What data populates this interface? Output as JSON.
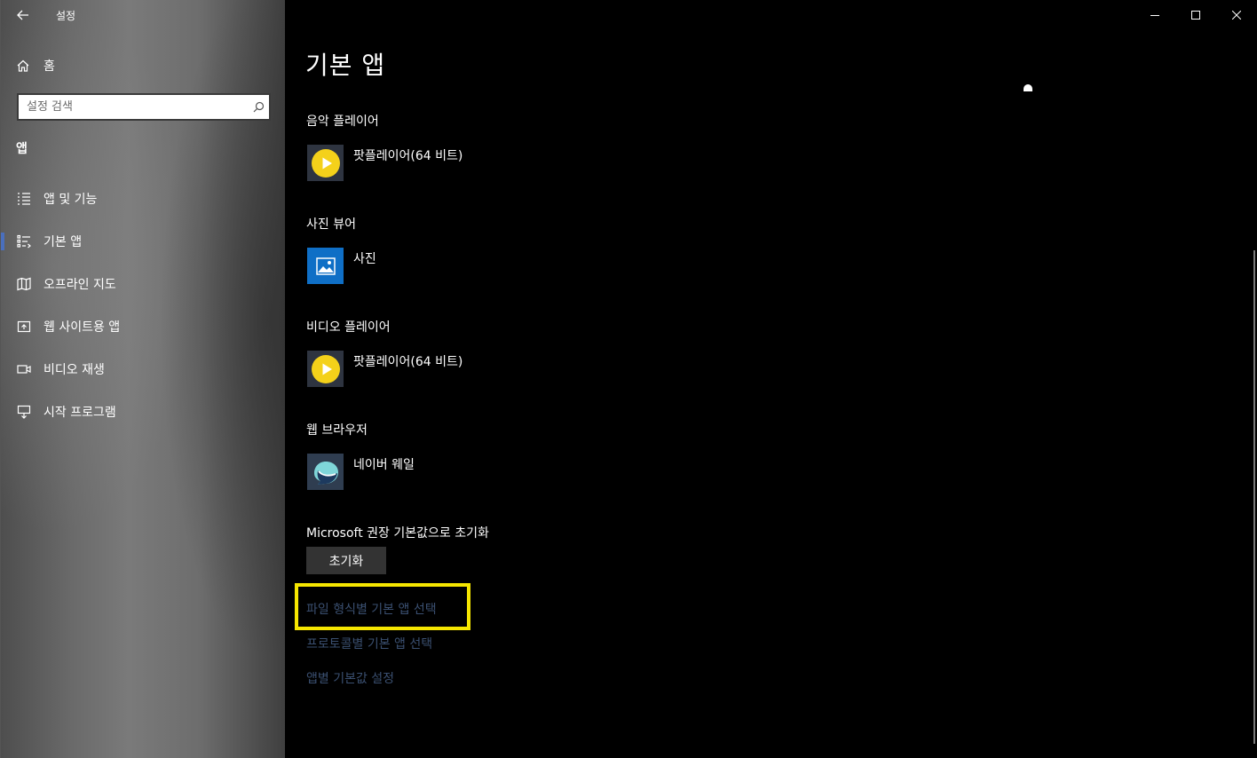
{
  "window": {
    "title": "설정",
    "controls": {
      "minimize": "minimize-icon",
      "maximize": "maximize-icon",
      "close": "close-icon"
    }
  },
  "sidebar": {
    "home_label": "홈",
    "search_placeholder": "설정 검색",
    "section_title": "앱",
    "items": [
      {
        "label": "앱 및 기능",
        "icon": "apps-features-icon"
      },
      {
        "label": "기본 앱",
        "icon": "default-apps-icon",
        "active": true
      },
      {
        "label": "오프라인 지도",
        "icon": "offline-maps-icon"
      },
      {
        "label": "웹 사이트용 앱",
        "icon": "apps-for-websites-icon"
      },
      {
        "label": "비디오 재생",
        "icon": "video-playback-icon"
      },
      {
        "label": "시작 프로그램",
        "icon": "startup-icon"
      }
    ],
    "accent_color": "#4a6fbd"
  },
  "main": {
    "title": "기본 앱",
    "groups": [
      {
        "label": "음악 플레이어",
        "app": "팟플레이어(64 비트)",
        "icon": "potplayer-icon"
      },
      {
        "label": "사진 뷰어",
        "app": "사진",
        "icon": "photos-icon"
      },
      {
        "label": "비디오 플레이어",
        "app": "팟플레이어(64 비트)",
        "icon": "potplayer-icon"
      },
      {
        "label": "웹 브라우저",
        "app": "네이버 웨일",
        "icon": "naver-whale-icon"
      }
    ],
    "reset_label": "Microsoft 권장 기본값으로 초기화",
    "reset_button": "초기화",
    "links": [
      "파일 형식별 기본 앱 선택",
      "프로토콜별 기본 앱 선택",
      "앱별 기본값 설정"
    ],
    "highlight_color": "#f5e600",
    "link_color": "#3a4f70"
  }
}
